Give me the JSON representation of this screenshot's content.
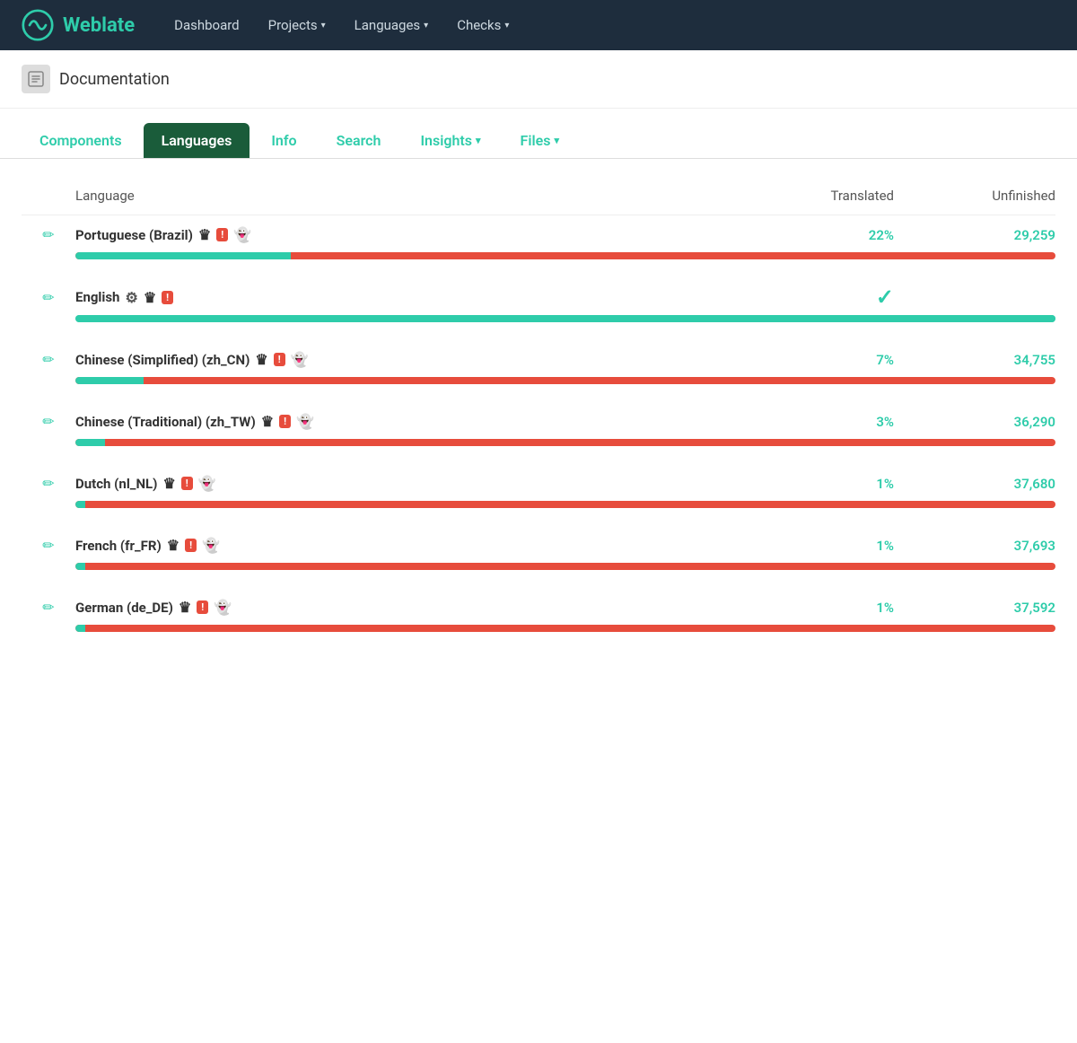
{
  "navbar": {
    "brand": "Weblate",
    "links": [
      {
        "label": "Dashboard",
        "has_dropdown": false
      },
      {
        "label": "Projects",
        "has_dropdown": true
      },
      {
        "label": "Languages",
        "has_dropdown": true
      },
      {
        "label": "Checks",
        "has_dropdown": true
      }
    ]
  },
  "breadcrumb": {
    "icon": "📦",
    "text": "Documentation"
  },
  "tabs": [
    {
      "label": "Components",
      "active": false,
      "has_dropdown": false
    },
    {
      "label": "Languages",
      "active": true,
      "has_dropdown": false
    },
    {
      "label": "Info",
      "active": false,
      "has_dropdown": false
    },
    {
      "label": "Search",
      "active": false,
      "has_dropdown": false
    },
    {
      "label": "Insights",
      "active": false,
      "has_dropdown": true
    },
    {
      "label": "Files",
      "active": false,
      "has_dropdown": true
    }
  ],
  "table": {
    "col_language": "Language",
    "col_translated": "Translated",
    "col_unfinished": "Unfinished"
  },
  "languages": [
    {
      "name": "Portuguese (Brazil)",
      "badges": [
        "crown",
        "alert",
        "ghost"
      ],
      "translated": "22%",
      "translated_pct": 22,
      "unfinished": "29,259",
      "is_source": false,
      "complete": false
    },
    {
      "name": "English",
      "badges": [
        "source",
        "crown",
        "alert"
      ],
      "translated": "",
      "translated_pct": 100,
      "unfinished": "",
      "is_source": true,
      "complete": true
    },
    {
      "name": "Chinese (Simplified) (zh_CN)",
      "badges": [
        "crown",
        "alert",
        "ghost"
      ],
      "translated": "7%",
      "translated_pct": 7,
      "unfinished": "34,755",
      "is_source": false,
      "complete": false
    },
    {
      "name": "Chinese (Traditional) (zh_TW)",
      "badges": [
        "crown",
        "alert",
        "ghost"
      ],
      "translated": "3%",
      "translated_pct": 3,
      "unfinished": "36,290",
      "is_source": false,
      "complete": false
    },
    {
      "name": "Dutch (nl_NL)",
      "badges": [
        "crown",
        "alert",
        "ghost"
      ],
      "translated": "1%",
      "translated_pct": 1,
      "unfinished": "37,680",
      "is_source": false,
      "complete": false
    },
    {
      "name": "French (fr_FR)",
      "badges": [
        "crown",
        "alert",
        "ghost"
      ],
      "translated": "1%",
      "translated_pct": 1,
      "unfinished": "37,693",
      "is_source": false,
      "complete": false
    },
    {
      "name": "German (de_DE)",
      "badges": [
        "crown",
        "alert",
        "ghost"
      ],
      "translated": "1%",
      "translated_pct": 1,
      "unfinished": "37,592",
      "is_source": false,
      "complete": false
    }
  ],
  "colors": {
    "brand": "#2eccaa",
    "nav_bg": "#1e2d3d",
    "active_tab": "#1a5c3a",
    "progress_green": "#2eccaa",
    "progress_red": "#e74c3c"
  }
}
